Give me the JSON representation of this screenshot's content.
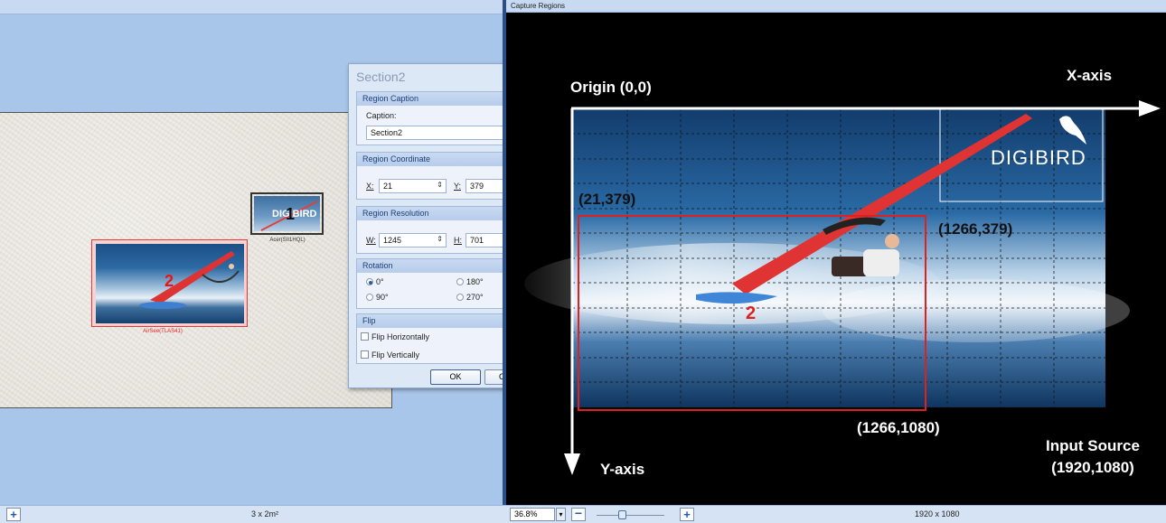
{
  "right_header": {
    "title": "Capture Regions"
  },
  "left": {
    "region1_label": "Acer(SII1HQL)",
    "region1_number": "1",
    "region1_logo": "DIGIBIRD",
    "region2_label": "AirSee(TLAS41)",
    "region2_number": "2"
  },
  "dialog": {
    "title": "Section2",
    "close": "×",
    "caption_group": "Region Caption",
    "caption_label": "Caption:",
    "caption_value": "Section2",
    "coord_group": "Region Coordinate",
    "x_label": "X:",
    "x_value": "21",
    "y_label": "Y:",
    "y_value": "379",
    "res_group": "Region Resolution",
    "w_label": "W:",
    "w_value": "1245",
    "h_label": "H:",
    "h_value": "701",
    "rotation_group": "Rotation",
    "rot_0": "0°",
    "rot_180": "180°",
    "rot_90": "90°",
    "rot_270": "270°",
    "rotation_selected": "0°",
    "flip_group": "Flip",
    "flip_h": "Flip Horizontally",
    "flip_v": "Flip Vertically",
    "ok": "OK",
    "cancel": "Cancel"
  },
  "preview": {
    "origin": "Origin (0,0)",
    "x_axis": "X-axis",
    "y_axis": "Y-axis",
    "logo": "DIGIBIRD",
    "coord_top_left": "(21,379)",
    "coord_top_right": "(1266,379)",
    "coord_bottom_right": "(1266,1080)",
    "region_number": "2",
    "input_source_line1": "Input Source",
    "input_source_line2": "(1920,1080)"
  },
  "statusbar": {
    "left_text": "3 x 2m²",
    "zoom": "36.8%",
    "resolution": "1920 x 1080"
  },
  "colors": {
    "accent": "#2a4f86",
    "region_red": "#e02020",
    "pane_blue": "#a8c6ea"
  }
}
